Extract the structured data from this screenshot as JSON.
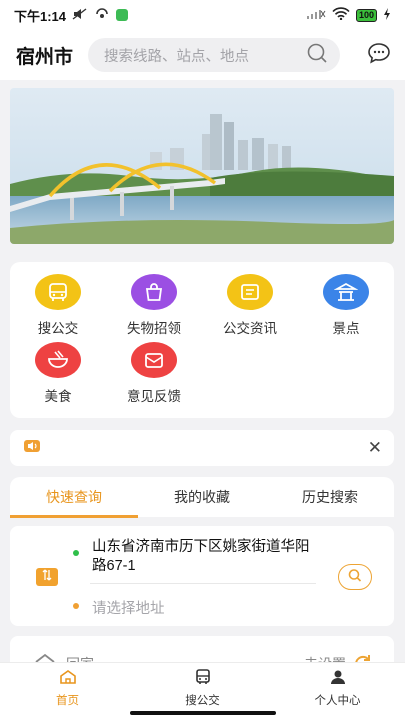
{
  "status_bar": {
    "time": "下午1:14",
    "battery": "100"
  },
  "header": {
    "city": "宿州市",
    "search_placeholder": "搜索线路、站点、地点"
  },
  "features": [
    {
      "label": "搜公交",
      "icon": "bus-search-icon",
      "color": "#f3c316"
    },
    {
      "label": "失物招领",
      "icon": "lost-found-bag-icon",
      "color": "#9b4fe3"
    },
    {
      "label": "公交资讯",
      "icon": "news-board-icon",
      "color": "#f3c316"
    },
    {
      "label": "景点",
      "icon": "pavilion-icon",
      "color": "#3b84e8"
    },
    {
      "label": "美食",
      "icon": "food-bowl-icon",
      "color": "#ee4242"
    },
    {
      "label": "意见反馈",
      "icon": "feedback-envelope-icon",
      "color": "#ee4242"
    }
  ],
  "query_tabs": {
    "quick": "快速查询",
    "favorites": "我的收藏",
    "history": "历史搜索"
  },
  "route": {
    "from": "山东省济南市历下区姚家街道华阳路67-1",
    "to_placeholder": "请选择地址"
  },
  "shortcut": {
    "home": "回家",
    "set": "去设置"
  },
  "tabbar": {
    "home": "首页",
    "bus": "搜公交",
    "profile": "个人中心"
  },
  "colors": {
    "accent": "#e8951d",
    "from_dot": "#2fbf4a",
    "to_dot": "#f0a033"
  }
}
